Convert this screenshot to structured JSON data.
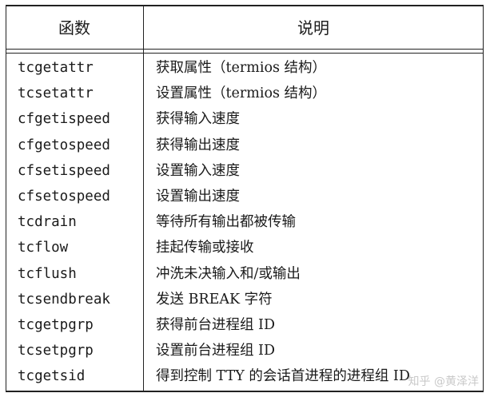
{
  "table": {
    "headers": {
      "function": "函数",
      "description": "说明"
    },
    "rows": [
      {
        "function": "tcgetattr",
        "description": "获取属性（termios 结构）"
      },
      {
        "function": "tcsetattr",
        "description": "设置属性（termios 结构）"
      },
      {
        "function": "cfgetispeed",
        "description": "获得输入速度"
      },
      {
        "function": "cfgetospeed",
        "description": "获得输出速度"
      },
      {
        "function": "cfsetispeed",
        "description": "设置输入速度"
      },
      {
        "function": "cfsetospeed",
        "description": "设置输出速度"
      },
      {
        "function": "tcdrain",
        "description": "等待所有输出都被传输"
      },
      {
        "function": "tcflow",
        "description": "挂起传输或接收"
      },
      {
        "function": "tcflush",
        "description": "冲洗未决输入和/或输出"
      },
      {
        "function": "tcsendbreak",
        "description": "发送 BREAK 字符"
      },
      {
        "function": "tcgetpgrp",
        "description": "获得前台进程组 ID"
      },
      {
        "function": "tcsetpgrp",
        "description": "设置前台进程组 ID"
      },
      {
        "function": "tcgetsid",
        "description": "得到控制 TTY 的会话首进程的进程组 ID"
      }
    ]
  },
  "watermark": "知乎 @黄泽洋"
}
